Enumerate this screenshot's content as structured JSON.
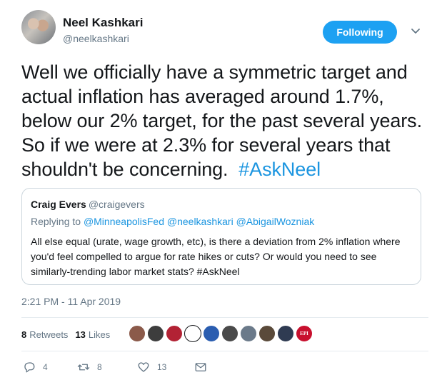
{
  "author": {
    "name": "Neel Kashkari",
    "handle": "@neelkashkari"
  },
  "follow_button": {
    "label": "Following"
  },
  "tweet": {
    "text": "Well we officially have a symmetric target and actual inflation has averaged around 1.7%, below our 2% target, for the past several years.  So if we were at 2.3% for several years that shouldn't be concerning.  ",
    "hashtag": "#AskNeel"
  },
  "quote": {
    "name": "Craig Evers",
    "handle": "@craigevers",
    "replying_prefix": "Replying to ",
    "mentions": "@MinneapolisFed @neelkashkari @AbigailWozniak",
    "body": "All else equal (urate, wage growth, etc), is there a deviation from 2% inflation where you'd feel compelled to argue for rate hikes or cuts? Or would you need to see similarly-trending labor market stats? #AskNeel"
  },
  "timestamp": "2:21 PM - 11 Apr 2019",
  "stats": {
    "retweets_count": "8",
    "retweets_label": "Retweets",
    "likes_count": "13",
    "likes_label": "Likes"
  },
  "likers": [
    {
      "color": "#8b5a4a"
    },
    {
      "color": "#3d3d3d"
    },
    {
      "color": "#b22234"
    },
    {
      "color": "#ffffff",
      "kind": "cloud"
    },
    {
      "color": "#2a5db0"
    },
    {
      "color": "#4a4a4a"
    },
    {
      "color": "#6b7a8a"
    },
    {
      "color": "#5a4a3a"
    },
    {
      "color": "#2f3b52"
    },
    {
      "color": "#c8102e",
      "kind": "epi",
      "text": "EPI"
    }
  ],
  "actions": {
    "replies": "4",
    "retweets": "8",
    "likes": "13"
  },
  "colors": {
    "accent": "#1da1f2",
    "link": "#1b95e0",
    "muted": "#657786"
  },
  "icons": [
    "caret-down-icon",
    "reply-icon",
    "retweet-icon",
    "heart-icon",
    "message-icon"
  ]
}
